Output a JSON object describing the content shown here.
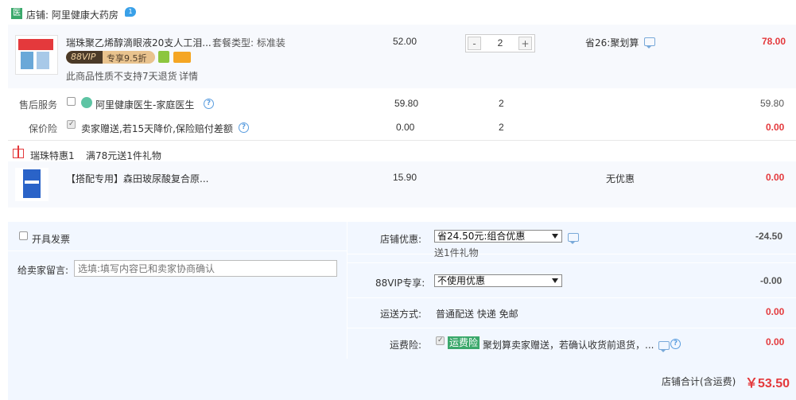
{
  "shop": {
    "badge": "医",
    "name": "店铺: 阿里健康大药房",
    "ww_label": "1"
  },
  "item1": {
    "title": "瑞珠聚乙烯醇滴眼液20支人工泪...",
    "package": "套餐类型: 标准装",
    "vip": "88VIP",
    "vip_discount": "专享9.5折",
    "notice": "此商品性质不支持7天退货",
    "detail": "详情",
    "price": "52.00",
    "qty": "2",
    "minus": "-",
    "plus": "+",
    "promo": "省26:聚划算",
    "total": "78.00"
  },
  "service": {
    "label": "售后服务",
    "name": "阿里健康医生-家庭医生",
    "price": "59.80",
    "qty": "2",
    "total": "59.80"
  },
  "insurance": {
    "label": "保价险",
    "name": "卖家赠送,若15天降价,保险赔付差额",
    "price": "0.00",
    "qty": "2",
    "total": "0.00"
  },
  "gift_group": {
    "title": "瑞珠特惠1",
    "rule": "满78元送1件礼物"
  },
  "item2": {
    "title": "【搭配专用】森田玻尿酸复合原...",
    "price": "15.90",
    "promo": "无优惠",
    "total": "0.00"
  },
  "invoice": {
    "label": "开具发票"
  },
  "message": {
    "label": "给卖家留言:",
    "placeholder": "选填:填写内容已和卖家协商确认"
  },
  "shop_discount": {
    "label": "店铺优惠:",
    "selected": "省24.50元:组合优惠",
    "sub": "送1件礼物",
    "amount": "-24.50"
  },
  "vip_discount": {
    "label": "88VIP专享:",
    "selected": "不使用优惠",
    "amount": "-0.00"
  },
  "shipping": {
    "label": "运送方式:",
    "value": "普通配送 快递 免邮",
    "amount": "0.00"
  },
  "freight_ins": {
    "label": "运费险:",
    "tag": "运费险",
    "desc": "聚划算卖家赠送，若确认收货前退货，...",
    "amount": "0.00"
  },
  "summary": {
    "label": "店铺合计(含运费)",
    "amount": "￥53.50"
  },
  "colors": {
    "accent_red": "#e4393c",
    "panel_bg": "#f2f7ff",
    "vip_dark": "#4b3a28",
    "vip_gold": "#e9c38e",
    "tag_green": "#3aa86b"
  }
}
